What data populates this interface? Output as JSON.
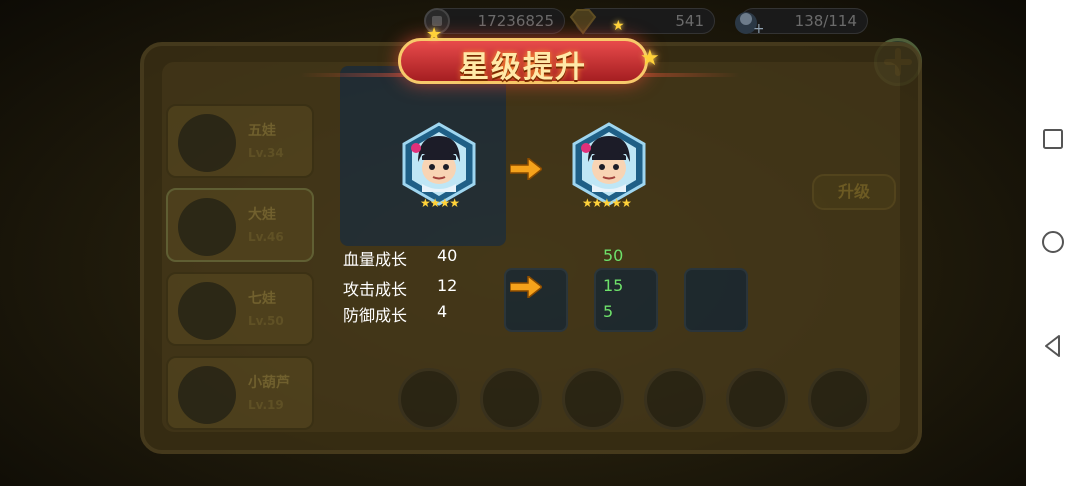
{
  "resources": {
    "coins": "17236825",
    "gems": "541",
    "stamina": "138/114"
  },
  "background": {
    "heroes": [
      {
        "name": "五娃",
        "level": "Lv.34"
      },
      {
        "name": "大娃",
        "level": "Lv.46"
      },
      {
        "name": "七娃",
        "level": "Lv.50"
      },
      {
        "name": "小葫芦",
        "level": "Lv.19"
      }
    ],
    "upgrade_label": "升级"
  },
  "modal": {
    "title": "星级提升",
    "stats": [
      {
        "label": "血量成长",
        "old": "40",
        "new": "50"
      },
      {
        "label": "攻击成长",
        "old": "12",
        "new": "15"
      },
      {
        "label": "防御成长",
        "old": "4",
        "new": "5"
      }
    ],
    "stars_before": 4,
    "stars_after": 5
  },
  "colors": {
    "new_value": "#6ee06a",
    "ribbon": "#c62b2e",
    "arrow": "#f5a21b"
  },
  "nav": {
    "icons": [
      "recents-icon",
      "home-icon",
      "back-icon"
    ]
  }
}
